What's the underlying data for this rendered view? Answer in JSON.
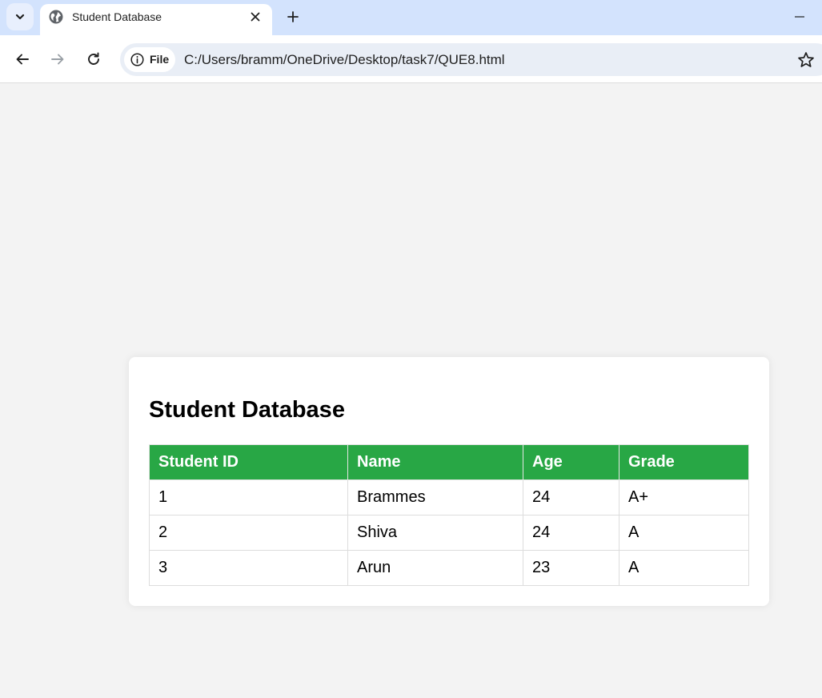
{
  "browser": {
    "tab_title": "Student Database",
    "address_chip_label": "File",
    "url": "C:/Users/bramm/OneDrive/Desktop/task7/QUE8.html"
  },
  "page": {
    "heading": "Student Database",
    "table": {
      "headers": [
        "Student ID",
        "Name",
        "Age",
        "Grade"
      ],
      "rows": [
        [
          "1",
          "Brammes",
          "24",
          "A+"
        ],
        [
          "2",
          "Shiva",
          "24",
          "A"
        ],
        [
          "3",
          "Arun",
          "23",
          "A"
        ]
      ]
    }
  },
  "colors": {
    "header_green": "#28a745",
    "tabstrip": "#d3e3fd",
    "page_background": "#f3f3f3"
  }
}
